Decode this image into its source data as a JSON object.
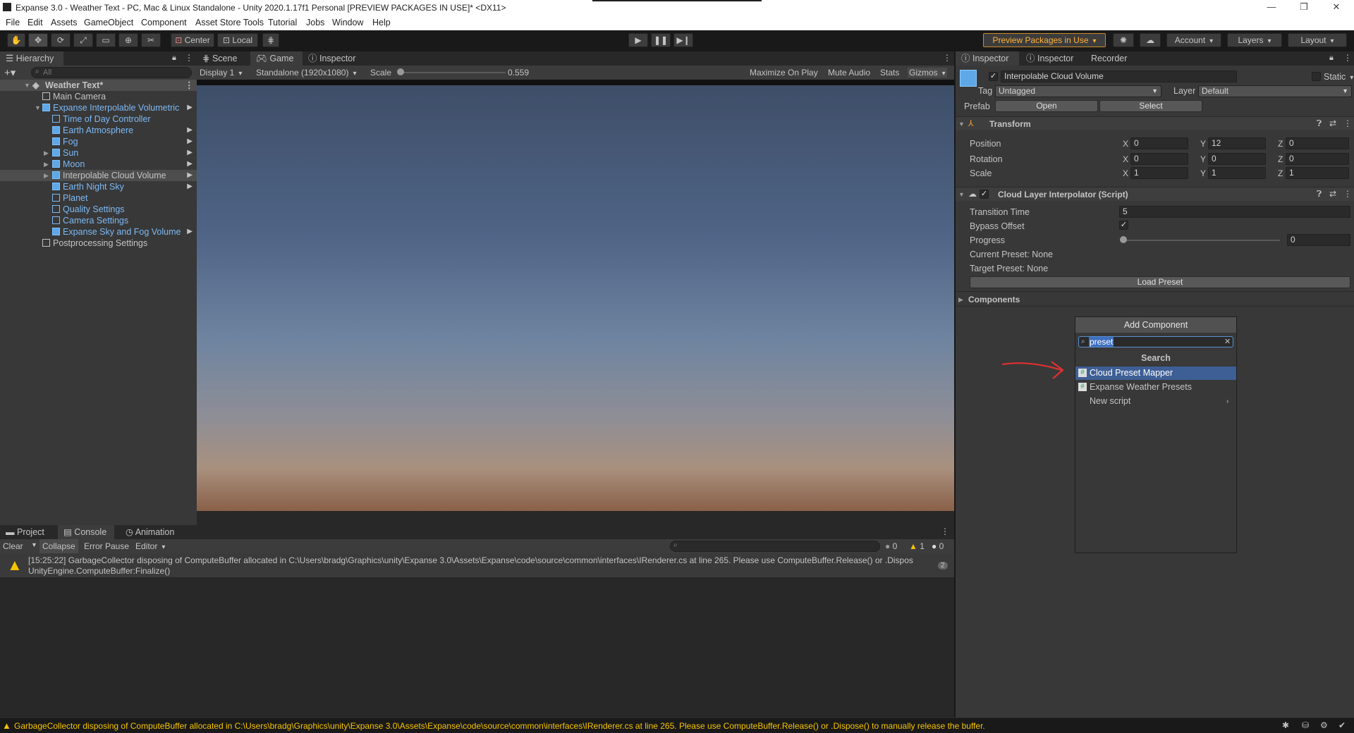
{
  "window": {
    "title": "Expanse 3.0 - Weather Text - PC, Mac & Linux Standalone - Unity 2020.1.17f1 Personal [PREVIEW PACKAGES IN USE]* <DX11>",
    "controls": [
      "—",
      "❐",
      "✕"
    ]
  },
  "menu": [
    "File",
    "Edit",
    "Assets",
    "GameObject",
    "Component",
    "Asset Store Tools",
    "Tutorial",
    "Jobs",
    "Window",
    "Help"
  ],
  "toolbar": {
    "pivot": "Center",
    "space": "Local",
    "preview_packages": "Preview Packages in Use",
    "account": "Account",
    "layers": "Layers",
    "layout": "Layout"
  },
  "hierarchy": {
    "tab": "Hierarchy",
    "search_placeholder": "All",
    "scene": "Weather Text*",
    "items": [
      {
        "label": "Main Camera"
      },
      {
        "label": "Expanse Interpolable Volumetric"
      },
      {
        "label": "Time of Day Controller"
      },
      {
        "label": "Earth Atmosphere"
      },
      {
        "label": "Fog"
      },
      {
        "label": "Sun"
      },
      {
        "label": "Moon"
      },
      {
        "label": "Interpolable Cloud Volume"
      },
      {
        "label": "Earth Night Sky"
      },
      {
        "label": "Planet"
      },
      {
        "label": "Quality Settings"
      },
      {
        "label": "Camera Settings"
      },
      {
        "label": "Expanse Sky and Fog Volume"
      },
      {
        "label": "Postprocessing Settings"
      }
    ]
  },
  "game_view": {
    "tabs": [
      "Scene",
      "Game",
      "Inspector"
    ],
    "display": "Display 1",
    "resolution": "Standalone (1920x1080)",
    "scale_label": "Scale",
    "scale_value": "0.559",
    "maximize": "Maximize On Play",
    "mute": "Mute Audio",
    "stats": "Stats",
    "gizmos": "Gizmos"
  },
  "console": {
    "tabs": [
      "Project",
      "Console",
      "Animation"
    ],
    "clear": "Clear",
    "collapse": "Collapse",
    "error_pause": "Error Pause",
    "editor": "Editor",
    "count_info": "0",
    "count_warn": "1",
    "count_err": "0",
    "log_line1": "[15:25:22] GarbageCollector disposing of ComputeBuffer allocated in C:\\Users\\bradg\\Graphics\\unity\\Expanse 3.0\\Assets\\Expanse\\code\\source\\common\\interfaces\\IRenderer.cs at line 265. Please use ComputeBuffer.Release() or .Dispos",
    "log_line2": "UnityEngine.ComputeBuffer:Finalize()",
    "log_count": "2"
  },
  "inspector": {
    "tabs": [
      "Inspector",
      "Inspector",
      "Recorder"
    ],
    "object_name": "Interpolable Cloud Volume",
    "static": "Static",
    "tag_label": "Tag",
    "tag_value": "Untagged",
    "layer_label": "Layer",
    "layer_value": "Default",
    "prefab_label": "Prefab",
    "open": "Open",
    "select": "Select",
    "transform": {
      "title": "Transform",
      "position_label": "Position",
      "rotation_label": "Rotation",
      "scale_label": "Scale",
      "position": [
        "0",
        "12",
        "0"
      ],
      "rotation": [
        "0",
        "0",
        "0"
      ],
      "scale": [
        "1",
        "1",
        "1"
      ]
    },
    "script": {
      "title": "Cloud Layer Interpolator (Script)",
      "transition_time_label": "Transition Time",
      "transition_time": "5",
      "bypass_offset_label": "Bypass Offset",
      "progress_label": "Progress",
      "progress": "0",
      "current_preset": "Current Preset: None",
      "target_preset": "Target Preset: None",
      "load_preset": "Load Preset"
    },
    "components_label": "Components",
    "add_component": {
      "title": "Add Component",
      "search_value": "preset",
      "header": "Search",
      "items": [
        "Cloud Preset Mapper",
        "Expanse Weather Presets",
        "New script"
      ]
    }
  },
  "status": {
    "message": "GarbageCollector disposing of ComputeBuffer allocated in C:\\Users\\bradg\\Graphics\\unity\\Expanse 3.0\\Assets\\Expanse\\code\\source\\common\\interfaces\\IRenderer.cs at line 265. Please use ComputeBuffer.Release() or .Dispose() to manually release the buffer."
  },
  "colors": {
    "accent_orange": "#ffa500",
    "selection_blue": "#3e5f96",
    "annotation_red": "#e03030"
  }
}
